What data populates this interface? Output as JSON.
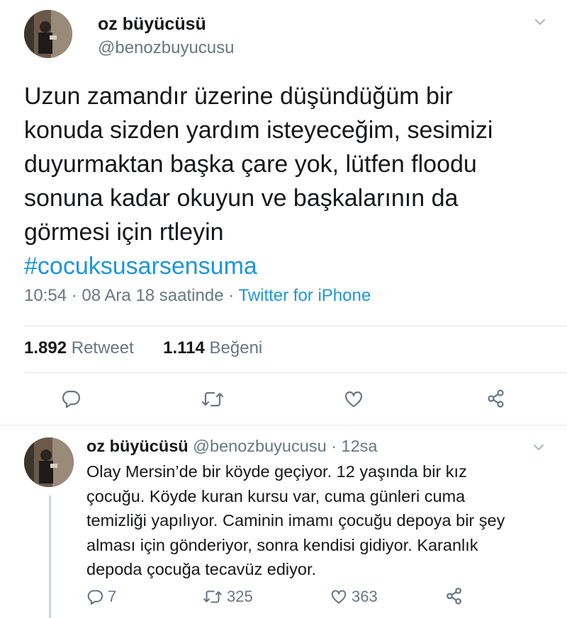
{
  "main_tweet": {
    "display_name": "oz büyücüsü",
    "handle": "@benozbuyucusu",
    "body_lines": [
      "Uzun zamandır üzerine düşündüğüm bir",
      "konuda sizden yardım isteyeceğim, sesimizi",
      "duyurmaktan başka çare yok, lütfen floodu",
      "sonuna kadar okuyun ve başkalarının da",
      "görmesi için rtleyin"
    ],
    "hashtag": "#cocuksusarsensuma",
    "timestamp": "10:54 · 08 Ara 18 saatinde · ",
    "source": "Twitter for iPhone",
    "retweet_count": "1.892",
    "retweet_label": "Retweet",
    "like_count": "1.114",
    "like_label": "Beğeni"
  },
  "reply_tweet": {
    "display_name": "oz büyücüsü",
    "handle": "@benozbuyucusu",
    "time": "· 12sa",
    "body_lines": [
      "Olay Mersin’de bir köyde geçiyor. 12 yaşında bir kız",
      "çocuğu. Köyde kuran kursu var, cuma günleri cuma",
      "temizliği yapılıyor. Caminin imamı çocuğu depoya bir şey",
      "alması için gönderiyor, sonra kendisi gidiyor. Karanlık",
      "depoda çocuğa tecavüz ediyor."
    ],
    "reply_count": "7",
    "retweet_count": "325",
    "like_count": "363"
  },
  "icons": {
    "reply": "reply-icon",
    "retweet": "retweet-icon",
    "like": "heart-icon",
    "share": "share-icon",
    "menu": "chevron-down-icon"
  },
  "colors": {
    "link": "#1b95e0",
    "secondary_text": "#657786",
    "divider": "#e1e8ed"
  }
}
